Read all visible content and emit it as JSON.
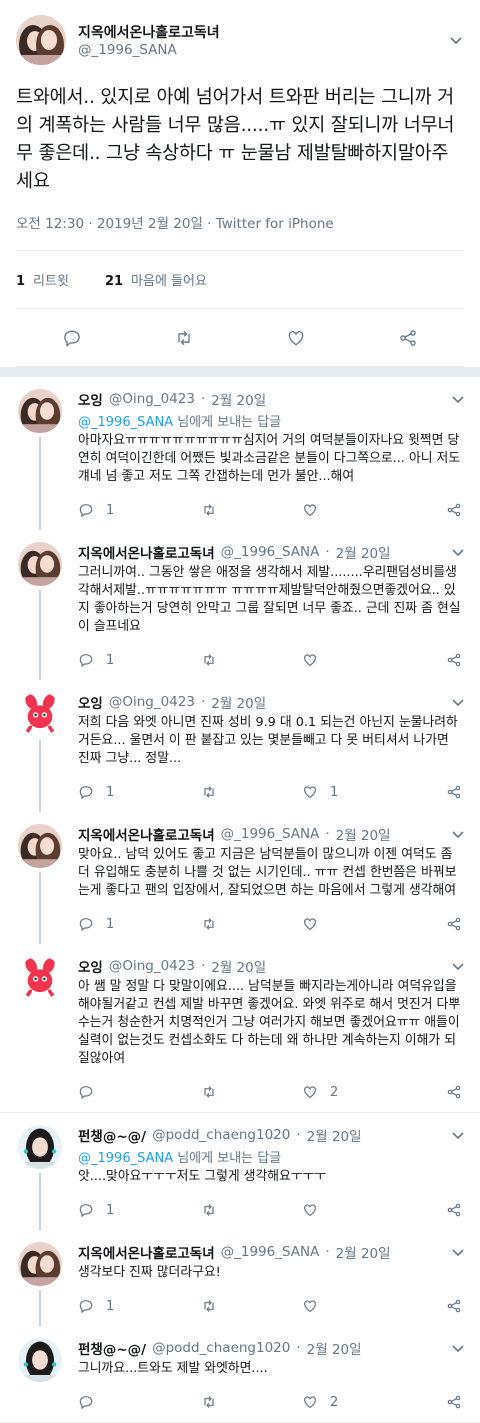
{
  "main_tweet": {
    "display_name": "지옥에서온나홀로고독녀",
    "handle": "@_1996_SANA",
    "text": "트와에서.. 있지로 아예 넘어가서 트와판 버리는 그니까 거의 계폭하는 사람들 너무 많음.....ㅠ 있지 잘되니까 너무너무 좋은데.. 그냥 속상하다 ㅠ 눈물남 제발탈빠하지말아주세요",
    "timestamp": "오전 12:30 · 2019년 2월 20일 · Twitter for iPhone",
    "retweet_count": "1",
    "retweet_label": "리트윗",
    "like_count": "21",
    "like_label": "마음에 들어요"
  },
  "icons": {
    "reply": "reply-icon",
    "retweet": "retweet-icon",
    "like": "heart-icon",
    "share": "share-icon",
    "menu": "chevron-down-icon"
  },
  "colors": {
    "link": "#1da1f2",
    "secondary": "#657786",
    "divider": "#e6ecf0",
    "oing_red": "#f0344f"
  },
  "replies": [
    {
      "avatar": "sana",
      "display_name": "오잉",
      "handle": "@Oing_0423",
      "date": "2월 20일",
      "to_prefix": "@_1996_SANA",
      "to_suffix": " 님에게 보내는 답글",
      "text": "아마자요ㅠㅠㅠㅠㅠㅠㅠㅠㅠㅠ심지어 거의 여덕분들이자나요 윗쩍면 당연히 여덕이긴한데 어쨌든 빛과소금같은 분들이 다그쪽으로... 아니 저도 걔네 넘 좋고 저도 그쪽 간잽하는데 먼가 불안...해여",
      "reply_count": "1",
      "retweet_count": "",
      "like_count": ""
    },
    {
      "avatar": "sana",
      "display_name": "지옥에서온나홀로고독녀",
      "handle": "@_1996_SANA",
      "date": "2월 20일",
      "to_prefix": "",
      "to_suffix": "",
      "text": "그러니까여.. 그동안 쌓은 애정을 생각해서 제발........우리팬덤성비를생각해서제발..ㅠㅠㅠㅠㅠㅠㅠ ㅠㅠㅠㅠ제발탈덕안해줬으면좋겠어요.. 있지 좋아하는거 당연히 안막고 그룹 잘되면 너무 좋죠.. 근데 진짜 좀 현실이 슬프네요",
      "reply_count": "1",
      "retweet_count": "",
      "like_count": ""
    },
    {
      "avatar": "oing",
      "display_name": "오잉",
      "handle": "@Oing_0423",
      "date": "2월 20일",
      "to_prefix": "",
      "to_suffix": "",
      "text": "저희 다음 와엣 아니면 진짜 성비 9.9 대 0.1 되는건 아닌지 눈물나려하거든요... 울면서 이 판 붙잡고 있는 몇분들빼고 다 못 버티셔서 나가면 진짜 그냥... 정말...",
      "reply_count": "1",
      "retweet_count": "",
      "like_count": "1"
    },
    {
      "avatar": "sana",
      "display_name": "지옥에서온나홀로고독녀",
      "handle": "@_1996_SANA",
      "date": "2월 20일",
      "to_prefix": "",
      "to_suffix": "",
      "text": "맞아요.. 남덕 있어도 좋고 지금은 남덕분들이 많으니까 이젠 여덕도 좀 더 유입해도 충분히 나쁠 것 없는 시기인데.. ㅠㅠ 컨셉 한번쯤은 바꿔보는게 좋다고 팬의 입장에서, 잘되었으면 하는 마음에서 그렇게 생각해여",
      "reply_count": "1",
      "retweet_count": "",
      "like_count": ""
    },
    {
      "avatar": "oing",
      "display_name": "오잉",
      "handle": "@Oing_0423",
      "date": "2월 20일",
      "to_prefix": "",
      "to_suffix": "",
      "text": "아 쌤 말 정말 다 맞말이에요.... 남덕분들 빠지라는게아니라 여덕유입을 해야될거같고 컨셉 제발 바꾸면 좋겠어요. 와엣 위주로 해서 멋진거 다뿌수는거 청순한거 치명적인거 그냥 여러가지 해보면 좋겠어요ㅠㅠ 애들이 실력이 없는것도 컨셉소화도 다 하는데 왜 하나만 계속하는지 이해가 되질않아여",
      "reply_count": "",
      "retweet_count": "",
      "like_count": "2"
    },
    {
      "avatar": "chaeng",
      "display_name": "펀챙@~@/",
      "handle": "@podd_chaeng1020",
      "date": "2월 20일",
      "to_prefix": "@_1996_SANA",
      "to_suffix": " 님에게 보내는 답글",
      "text": "앗....맞아요ㅜㅜㅜ저도 그렇게 생각해요ㅜㅜㅜ",
      "reply_count": "1",
      "retweet_count": "",
      "like_count": ""
    },
    {
      "avatar": "sana",
      "display_name": "지옥에서온나홀로고독녀",
      "handle": "@_1996_SANA",
      "date": "2월 20일",
      "to_prefix": "",
      "to_suffix": "",
      "text": "생각보다 진짜 많더라구요!",
      "reply_count": "1",
      "retweet_count": "",
      "like_count": ""
    },
    {
      "avatar": "chaeng",
      "display_name": "펀챙@~@/",
      "handle": "@podd_chaeng1020",
      "date": "2월 20일",
      "to_prefix": "",
      "to_suffix": "",
      "text": "그니까요...트와도 제발 와엣하면....",
      "reply_count": "",
      "retweet_count": "",
      "like_count": "2"
    }
  ]
}
